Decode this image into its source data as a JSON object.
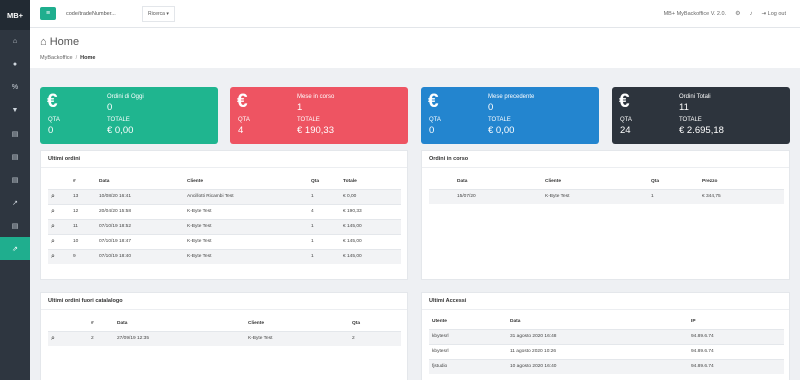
{
  "brand": "MB+",
  "topbar": {
    "search_value": "code/tradeNumber...",
    "search_button": "Ricerca ▾",
    "version": "MB+ MyBackoffice V. 2.0.",
    "logout": "Log out"
  },
  "page": {
    "title": "Home",
    "breadcrumb_root": "MyBackoffice",
    "breadcrumb_sep": "/",
    "breadcrumb_current": "Home"
  },
  "stats": [
    {
      "title": "Ordini di Oggi",
      "count": "0",
      "qta_label": "QTA",
      "qta": "0",
      "totale_label": "TOTALE",
      "totale": "€ 0,00",
      "color": "#1fb58f"
    },
    {
      "title": "Mese in corso",
      "count": "1",
      "qta_label": "QTA",
      "qta": "4",
      "totale_label": "TOTALE",
      "totale": "€ 190,33",
      "color": "#ee5462"
    },
    {
      "title": "Mese precedente",
      "count": "0",
      "qta_label": "QTA",
      "qta": "0",
      "totale_label": "TOTALE",
      "totale": "€ 0,00",
      "color": "#2385cf"
    },
    {
      "title": "Ordini Totali",
      "count": "11",
      "qta_label": "QTA",
      "qta": "24",
      "totale_label": "TOTALE",
      "totale": "€ 2.695,18",
      "color": "#2d343d"
    }
  ],
  "ultimi_ordini": {
    "title": "Ultimi ordini",
    "headers": [
      "#",
      "Data",
      "Cliente",
      "Qta",
      "Totale"
    ],
    "rows": [
      [
        "13",
        "10/08/20 16:41",
        "Ancillotti Ricambi Test",
        "1",
        "€ 0,00"
      ],
      [
        "12",
        "20/04/20 15:58",
        "K-Byte Test",
        "4",
        "€ 190,33"
      ],
      [
        "11",
        "07/10/19 18:52",
        "K-Byte Test",
        "1",
        "€ 145,00"
      ],
      [
        "10",
        "07/10/19 18:47",
        "K-Byte Test",
        "1",
        "€ 145,00"
      ],
      [
        "9",
        "07/10/19 18:40",
        "K-Byte Test",
        "1",
        "€ 145,00"
      ]
    ]
  },
  "ordini_in_corso": {
    "title": "Ordini in corso",
    "headers": [
      "Data",
      "Cliente",
      "Qta",
      "Prezzo"
    ],
    "rows": [
      [
        "15/07/20",
        "K-Byte Test",
        "1",
        "€ 344,75"
      ]
    ]
  },
  "fuori_catalogo": {
    "title": "Ultimi ordini fuori catalalogo",
    "headers": [
      "#",
      "Data",
      "Cliente",
      "Qta"
    ],
    "rows": [
      [
        "2",
        "27/09/19 12:35",
        "K-Byte Test",
        "2"
      ]
    ]
  },
  "ultimi_accessi": {
    "title": "Ultimi Accessi",
    "headers": [
      "Utente",
      "Data",
      "IP"
    ],
    "rows": [
      [
        "kbytesrl",
        "31 agosto 2020 16:48",
        "94.89.6.74"
      ],
      [
        "kbytesrl",
        "11 agosto 2020 10:26",
        "94.89.6.74"
      ],
      [
        "fjstudio",
        "10 agosto 2020 16:40",
        "94.89.6.74"
      ]
    ]
  }
}
